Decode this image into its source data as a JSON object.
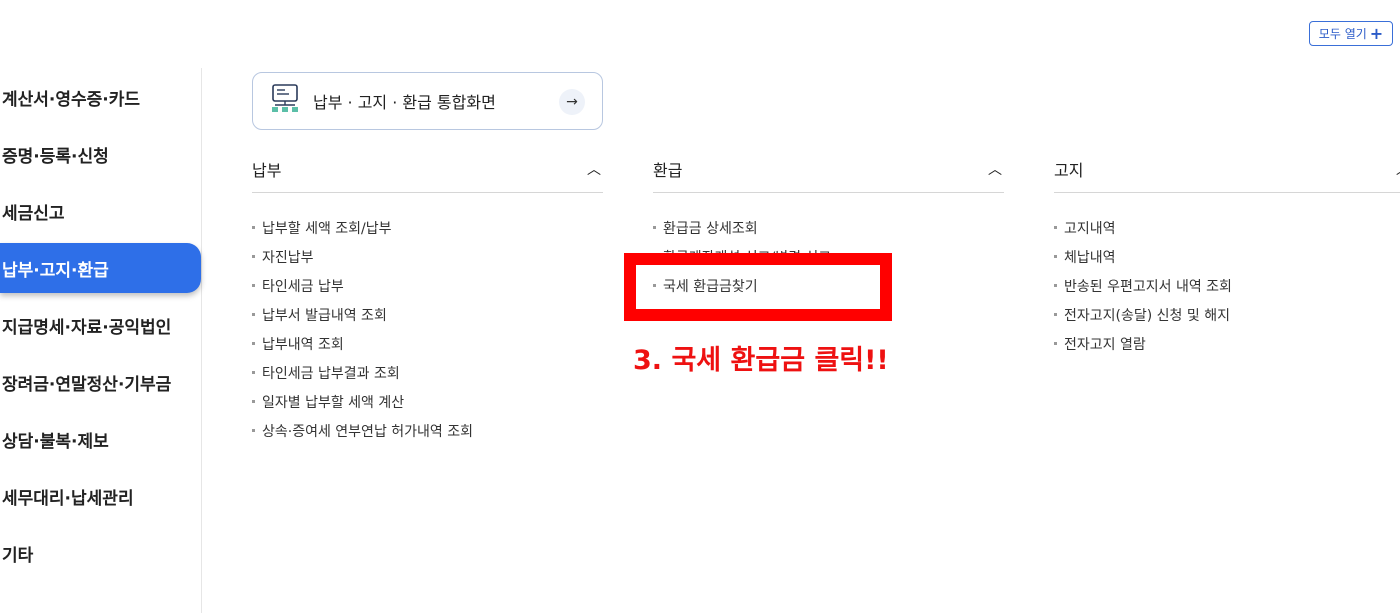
{
  "header": {
    "open_all_label": "모두 열기",
    "open_all_icon": "plus-icon"
  },
  "sidebar": {
    "items": [
      {
        "label": "계산서·영수증·카드",
        "active": false
      },
      {
        "label": "증명·등록·신청",
        "active": false
      },
      {
        "label": "세금신고",
        "active": false
      },
      {
        "label": "납부·고지·환급",
        "active": true
      },
      {
        "label": "지급명세·자료·공익법인",
        "active": false
      },
      {
        "label": "장려금·연말정산·기부금",
        "active": false
      },
      {
        "label": "상담·불복·제보",
        "active": false
      },
      {
        "label": "세무대리·납세관리",
        "active": false
      },
      {
        "label": "기타",
        "active": false
      }
    ],
    "active_color": "#2e6fe8"
  },
  "integrated": {
    "label": "납부 · 고지 · 환급 통합화면",
    "icon": "monitor-network-icon",
    "arrow_icon": "arrow-right-icon"
  },
  "columns": [
    {
      "title": "납부",
      "items": [
        "납부할 세액 조회/납부",
        "자진납부",
        "타인세금 납부",
        "납부서 발급내역 조회",
        "납부내역 조회",
        "타인세금 납부결과 조회",
        "일자별 납부할 세액 계산",
        "상속·증여세 연부연납 허가내역 조회"
      ]
    },
    {
      "title": "환급",
      "items": [
        "환급금 상세조회",
        "환급계좌개설 신고/변경 신고",
        "국세 환급금찾기"
      ]
    },
    {
      "title": "고지",
      "items": [
        "고지내역",
        "체납내역",
        "반송된 우편고지서 내역 조회",
        "전자고지(송달) 신청 및 해지",
        "전자고지 열람"
      ]
    }
  ],
  "annotation": {
    "text": "3. 국세 환급금 클릭!!",
    "color": "#ee1111"
  }
}
